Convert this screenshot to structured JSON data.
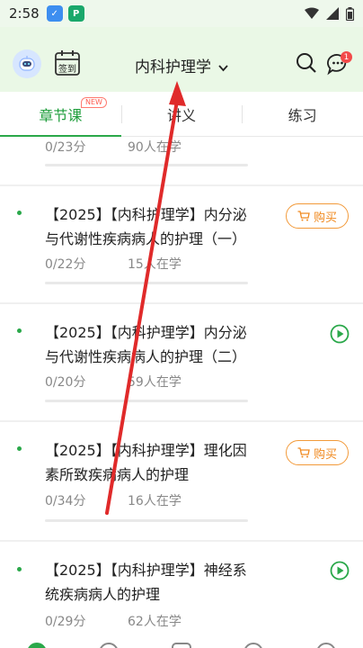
{
  "status_bar": {
    "time": "2:58",
    "app1_icon": "translate-app-icon",
    "app2_icon": "green-app-icon"
  },
  "header": {
    "title": "内科护理学",
    "calendar_label": "签到",
    "badge_count": "1"
  },
  "tabs": [
    {
      "label": "章节课",
      "badge": "NEW",
      "active": true
    },
    {
      "label": "讲义",
      "active": false
    },
    {
      "label": "练习",
      "active": false
    }
  ],
  "list": {
    "buy_label": "购买",
    "partial_item": {
      "score": "0/23分",
      "learners": "90人在学"
    },
    "items": [
      {
        "title_line1": "【2025】【内科护理学】内分泌",
        "title_line2": "与代谢性疾病病人的护理（一）",
        "score": "0/22分",
        "learners": "15人在学",
        "action": "buy"
      },
      {
        "title_line1": "【2025】【内科护理学】内分泌",
        "title_line2": "与代谢性疾病病人的护理（二）",
        "score": "0/20分",
        "learners": "59人在学",
        "action": "play"
      },
      {
        "title_line1": "【2025】【内科护理学】理化因",
        "title_line2": "素所致疾病病人的护理",
        "score": "0/34分",
        "learners": "16人在学",
        "action": "buy"
      },
      {
        "title_line1": "【2025】【内科护理学】神经系",
        "title_line2": "统疾病病人的护理",
        "score": "0/29分",
        "learners": "62人在学",
        "action": "play"
      }
    ]
  },
  "colors": {
    "accent": "#2aa84a",
    "buy": "#f08a20",
    "header_bg": "#eaf8e6",
    "annotation_arrow": "#e02a2a"
  }
}
